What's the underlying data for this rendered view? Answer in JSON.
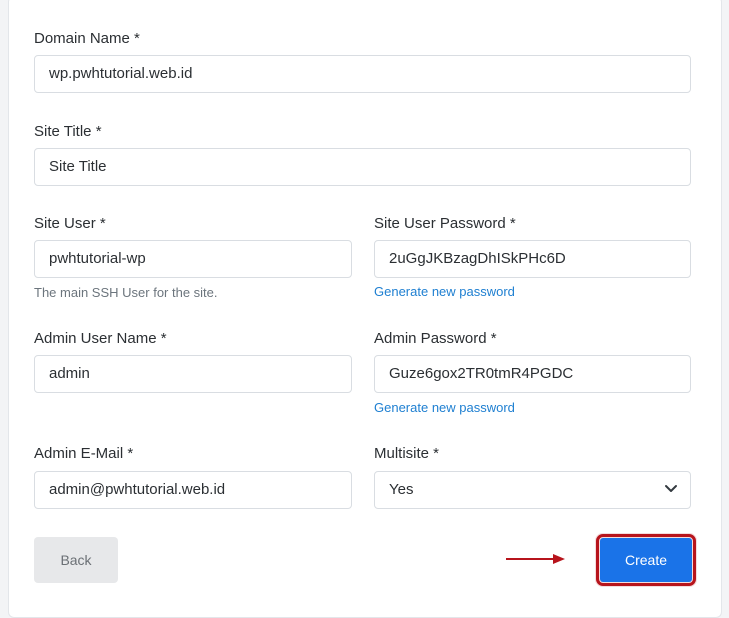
{
  "form": {
    "domain": {
      "label": "Domain Name *",
      "value": "wp.pwhtutorial.web.id"
    },
    "site_title": {
      "label": "Site Title *",
      "value": "Site Title"
    },
    "site_user": {
      "label": "Site User *",
      "value": "pwhtutorial-wp",
      "help": "The main SSH User for the site."
    },
    "site_user_password": {
      "label": "Site User Password *",
      "value": "2uGgJKBzagDhISkPHc6D",
      "generate_link": "Generate new password"
    },
    "admin_user": {
      "label": "Admin User Name *",
      "value": "admin"
    },
    "admin_password": {
      "label": "Admin Password *",
      "value": "Guze6gox2TR0tmR4PGDC",
      "generate_link": "Generate new password"
    },
    "admin_email": {
      "label": "Admin E-Mail *",
      "value": "admin@pwhtutorial.web.id"
    },
    "multisite": {
      "label": "Multisite *",
      "value": "Yes"
    }
  },
  "actions": {
    "back_label": "Back",
    "create_label": "Create"
  },
  "colors": {
    "primary": "#1a73e8",
    "highlight": "#b7141c",
    "link": "#1e7fd1"
  },
  "icons": {
    "select": "chevron-down-icon",
    "pointer": "red-arrow-icon"
  }
}
